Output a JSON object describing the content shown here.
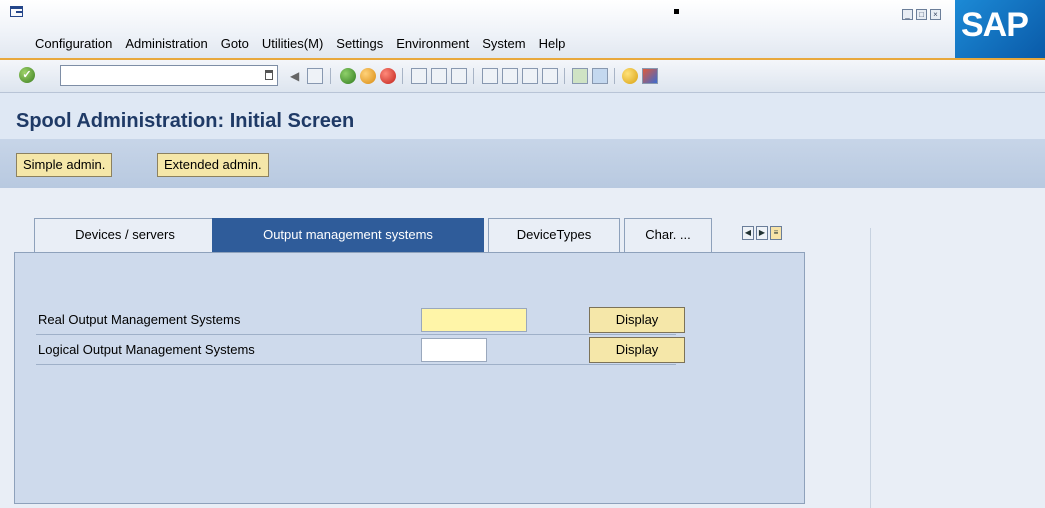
{
  "menubar": {
    "items": [
      "Configuration",
      "Administration",
      "Goto",
      "Utilities(M)",
      "Settings",
      "Environment",
      "System",
      "Help"
    ]
  },
  "logo": {
    "text": "SAP"
  },
  "toolbar": {
    "command_value": ""
  },
  "title": "Spool Administration: Initial Screen",
  "app_toolbar": {
    "simple_admin": "Simple admin.",
    "extended_admin": "Extended admin."
  },
  "tabs": [
    "Devices / servers",
    "Output management systems",
    "DeviceTypes",
    "Char. ..."
  ],
  "active_tab": "Output management systems",
  "form": {
    "real_label": "Real Output Management Systems",
    "logical_label": "Logical Output Management Systems",
    "real_value": "",
    "logical_value": "",
    "display_label": "Display"
  },
  "colors": {
    "title": "#1f3a66",
    "active_tab": "#2f5c9a",
    "button": "#f5e7a9",
    "required_field": "#fff5a8",
    "accent_line": "#e8a83c"
  }
}
